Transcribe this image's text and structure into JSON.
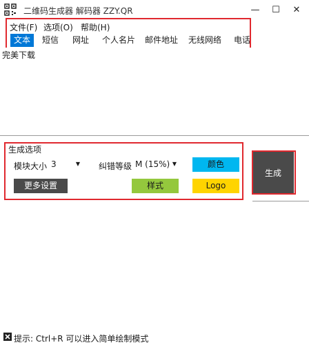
{
  "window": {
    "title": "二维码生成器 解码器 ZZY.QR",
    "minimize": "—",
    "maximize": "☐",
    "close": "✕"
  },
  "menu": {
    "items": [
      "文件(F)",
      "选项(O)",
      "帮助(H)"
    ]
  },
  "tabs": {
    "items": [
      "文本",
      "短信",
      "网址",
      "个人名片",
      "邮件地址",
      "无线网络",
      "电话"
    ],
    "active_index": 0
  },
  "text_input": {
    "value": "完美下载"
  },
  "options": {
    "section_title": "生成选项",
    "module_size_label": "模块大小",
    "module_size_value": "3",
    "error_level_label": "纠错等级",
    "error_level_value": "M (15%)",
    "color_button": "颜色",
    "more_settings_button": "更多设置",
    "style_button": "样式",
    "logo_button": "Logo"
  },
  "generate_button": "生成",
  "status": {
    "text": "提示: Ctrl+R 可以进入简单绘制模式"
  },
  "colors": {
    "accent": "#0078d7",
    "color_button": "#00b7f0",
    "style_button": "#94c83d",
    "logo_button": "#ffd400",
    "dark_button": "#4a4a4a",
    "highlight": "#e0282e"
  }
}
